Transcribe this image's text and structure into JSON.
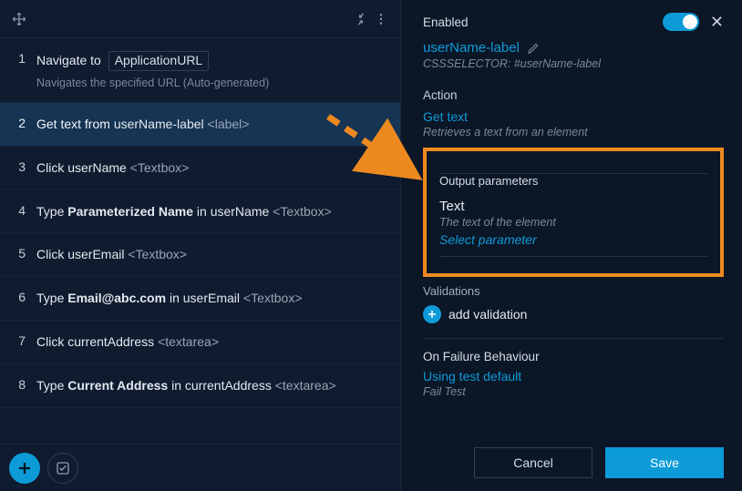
{
  "steps": [
    {
      "num": "1",
      "prefix": "Navigate to",
      "chip": "ApplicationURL",
      "target": "",
      "tag": "",
      "subtitle": "Navigates the specified URL (Auto-generated)"
    },
    {
      "num": "2",
      "prefix": "Get text from",
      "bold": "",
      "target": "userName-label",
      "tag": "<label>",
      "chip": "",
      "subtitle": ""
    },
    {
      "num": "3",
      "prefix": "Click",
      "bold": "",
      "target": "userName",
      "tag": "<Textbox>",
      "chip": "",
      "subtitle": ""
    },
    {
      "num": "4",
      "prefix": "Type",
      "bold": "Parameterized Name",
      "mid": " in ",
      "target": "userName",
      "tag": "<Textbox>",
      "chip": "",
      "subtitle": ""
    },
    {
      "num": "5",
      "prefix": "Click",
      "bold": "",
      "target": "userEmail",
      "tag": "<Textbox>",
      "chip": "",
      "subtitle": ""
    },
    {
      "num": "6",
      "prefix": "Type",
      "bold": "Email@abc.com",
      "mid": " in ",
      "target": "userEmail",
      "tag": "<Textbox>",
      "chip": "",
      "subtitle": ""
    },
    {
      "num": "7",
      "prefix": "Click",
      "bold": "",
      "target": "currentAddress",
      "tag": "<textarea>",
      "chip": "",
      "subtitle": ""
    },
    {
      "num": "8",
      "prefix": "Type",
      "bold": "Current Address",
      "mid": " in ",
      "target": "currentAddress",
      "tag": "<textarea>",
      "chip": "",
      "subtitle": ""
    }
  ],
  "right": {
    "enabled_label": "Enabled",
    "element_name": "userName-label",
    "selector": "CSSSELECTOR: #userName-label",
    "action_section": "Action",
    "action_name": "Get text",
    "action_desc": "Retrieves a text from an element",
    "output_label": "Output parameters",
    "param_name": "Text",
    "param_desc": "The text of the element",
    "select_param": "Select parameter",
    "validations_label": "Validations",
    "add_validation": "add validation",
    "failure_section": "On Failure Behaviour",
    "failure_value": "Using test default",
    "failure_sub": "Fail Test",
    "cancel": "Cancel",
    "save": "Save"
  },
  "colors": {
    "accent": "#0d9bd8",
    "highlight": "#ed8a1f"
  }
}
